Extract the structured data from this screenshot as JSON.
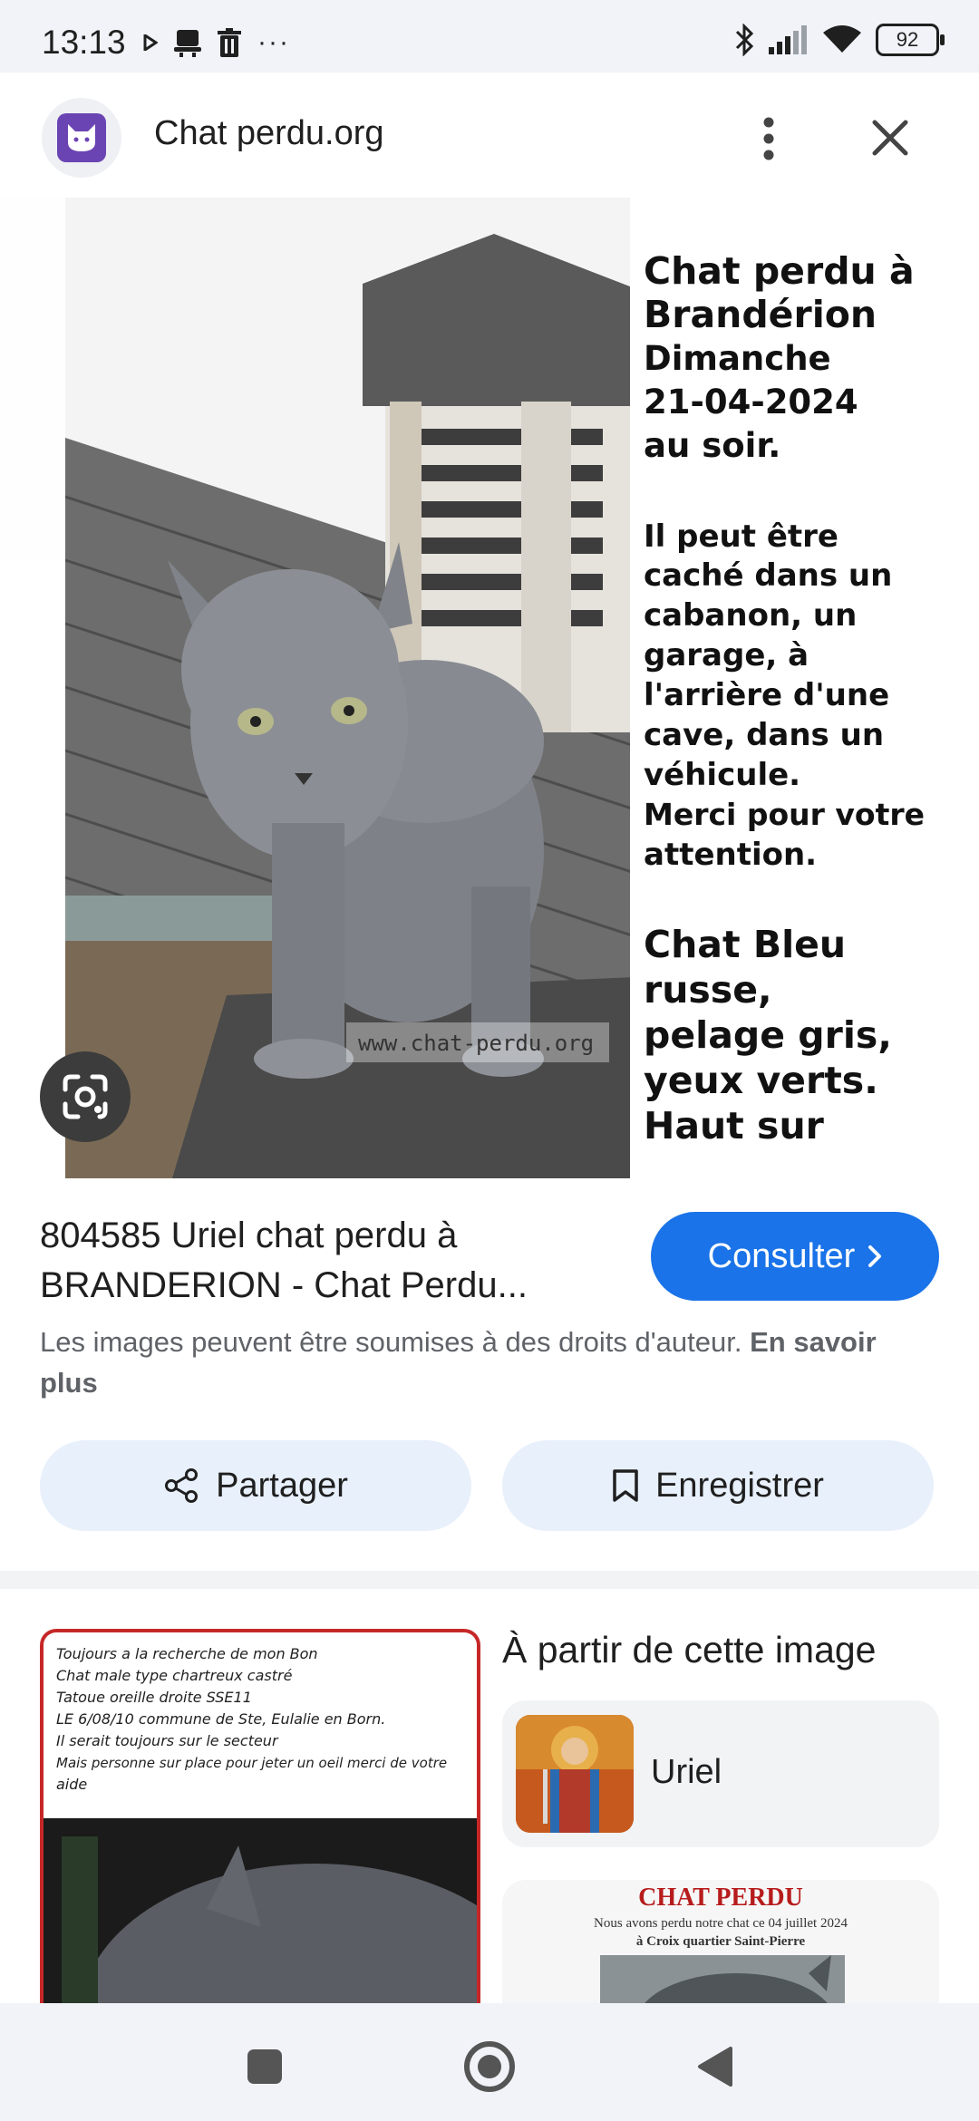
{
  "status_bar": {
    "time": "13:13",
    "left_icons": [
      "play-icon",
      "notification-icon",
      "trash-icon",
      "more-dots-icon"
    ],
    "more_label": "···",
    "right_icons": [
      "bluetooth-icon",
      "signal-icon",
      "wifi-icon",
      "battery-icon"
    ],
    "battery_level": "92"
  },
  "header": {
    "site_name": "Chat perdu.org",
    "site_icon": "cat-logo-icon",
    "more_icon": "more-vert-icon",
    "close_icon": "close-icon"
  },
  "main_image": {
    "heading_lines": [
      "Chat perdu à",
      "Brandérion",
      "Dimanche",
      "21-04-2024",
      "au soir."
    ],
    "body_lines": [
      "Il peut être",
      "caché dans un",
      "cabanon, un",
      "garage, à",
      "l'arrière d'une",
      "cave, dans un",
      "véhicule.",
      "Merci pour votre",
      "attention."
    ],
    "desc_lines": [
      "Chat Bleu",
      "russe,",
      "pelage gris,",
      "yeux verts.",
      "Haut sur"
    ],
    "watermark": "www.chat-perdu.org",
    "lens_icon": "lens-icon"
  },
  "result": {
    "title": "804585 Uriel chat perdu à BRANDERION - Chat Perdu...",
    "consult_label": "Consulter",
    "consult_icon": "chevron-right-icon",
    "copyright_text": "Les images peuvent être soumises à des droits d'auteur.",
    "learn_more": "En savoir plus"
  },
  "actions": {
    "share_label": "Partager",
    "share_icon": "share-icon",
    "save_label": "Enregistrer",
    "save_icon": "bookmark-icon"
  },
  "related": {
    "left_lines": [
      "Toujours a la recherche de mon Bon",
      "Chat male type chartreux castré",
      "Tatoue oreille droite SSE11",
      "LE 6/08/10 commune de Ste, Eulalie en Born.",
      "Il serait toujours sur le secteur",
      "Mais personne sur place pour jeter un oeil merci de votre",
      "aide"
    ],
    "from_image_title": "À partir de cette image",
    "uriel_label": "Uriel",
    "poster_title": "CHAT PERDU",
    "poster_sub1": "Nous avons perdu notre chat ce 04 juillet 2024",
    "poster_sub2": "à Croix quartier Saint-Pierre"
  },
  "nav": {
    "recent_icon": "square-icon",
    "home_icon": "home-circle-icon",
    "back_icon": "back-triangle-icon"
  },
  "colors": {
    "accent": "#1a73e8",
    "action_bg": "#e8f0fb",
    "status_bg": "#f1f3f8"
  }
}
